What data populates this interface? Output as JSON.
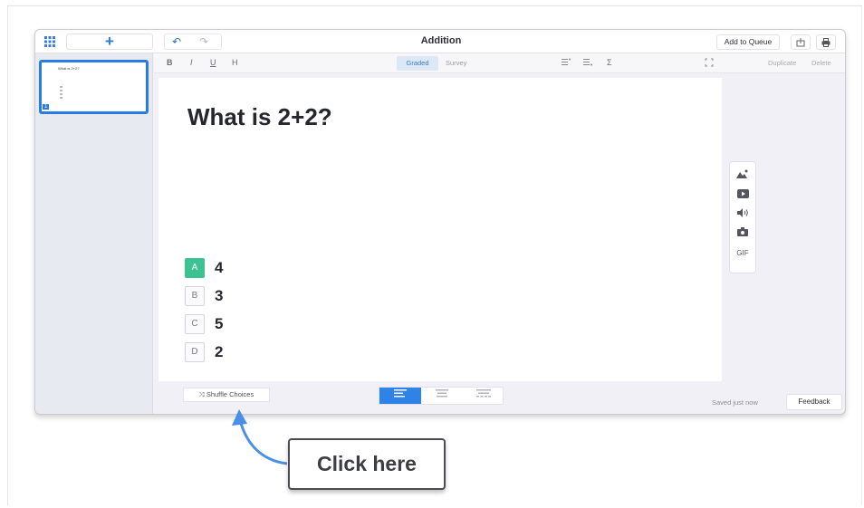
{
  "titlebar": {
    "title": "Addition",
    "add_slide_label": "+",
    "undo_label": "↶",
    "redo_label": "↷",
    "add_to_queue_label": "Add to Queue",
    "export_icon": "export-icon",
    "print_icon": "print-icon"
  },
  "sidebar": {
    "thumb_text": "What is 2+2?",
    "thumb_number": "1"
  },
  "format_toolbar": {
    "bold": "B",
    "italic": "I",
    "underline": "U",
    "heading": "H",
    "graded": "Graded",
    "survey": "Survey",
    "sigma": "Σ",
    "duplicate": "Duplicate",
    "delete": "Delete"
  },
  "question": {
    "text": "What is 2+2?",
    "choices": [
      {
        "letter": "A",
        "text": "4",
        "correct": true
      },
      {
        "letter": "B",
        "text": "3",
        "correct": false
      },
      {
        "letter": "C",
        "text": "5",
        "correct": false
      },
      {
        "letter": "D",
        "text": "2",
        "correct": false
      }
    ]
  },
  "media_toolbar": {
    "gif_label": "GIF"
  },
  "bottom": {
    "shuffle_label": "⤨ Shuffle Choices",
    "saved_status": "Saved just now",
    "feedback_label": "Feedback"
  },
  "callout": {
    "text": "Click here"
  },
  "colors": {
    "accent": "#2a7be4",
    "correct": "#3fc291"
  }
}
